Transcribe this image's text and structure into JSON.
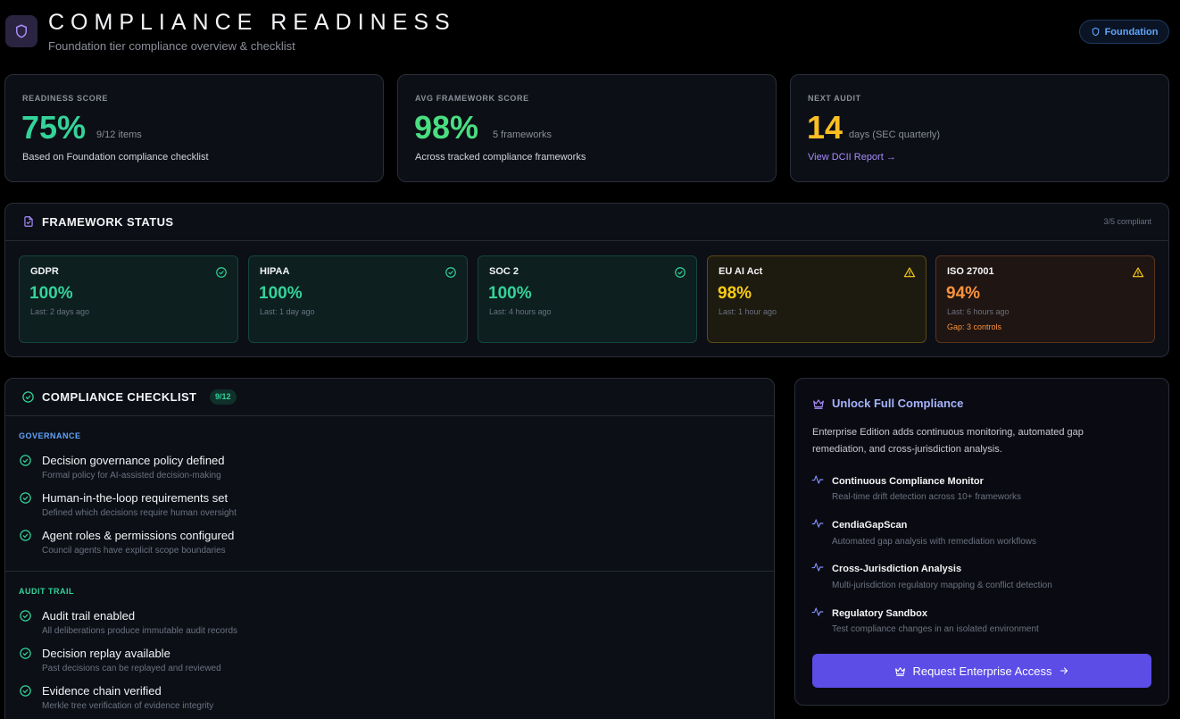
{
  "header": {
    "title": "COMPLIANCE READINESS",
    "subtitle": "Foundation tier compliance overview & checklist",
    "tier_badge": "Foundation"
  },
  "stats": [
    {
      "label": "READINESS SCORE",
      "value": "75%",
      "sub": "9/12 items",
      "desc": "Based on Foundation compliance checklist",
      "color": "#34d399"
    },
    {
      "label": "AVG FRAMEWORK SCORE",
      "value": "98%",
      "sub": "5 frameworks",
      "desc": "Across tracked compliance frameworks",
      "color": "#4ade80"
    },
    {
      "label": "NEXT AUDIT",
      "value": "14",
      "sub": "days (SEC quarterly)",
      "link": "View DCII Report →",
      "color": "#fbbf24"
    }
  ],
  "framework_status": {
    "title": "FRAMEWORK STATUS",
    "summary": "3/5 compliant",
    "items": [
      {
        "name": "GDPR",
        "score": "100%",
        "last": "Last: 2 days ago",
        "status": "ok",
        "icon": "check-circle-icon"
      },
      {
        "name": "HIPAA",
        "score": "100%",
        "last": "Last: 1 day ago",
        "status": "ok",
        "icon": "check-circle-icon"
      },
      {
        "name": "SOC 2",
        "score": "100%",
        "last": "Last: 4 hours ago",
        "status": "ok",
        "icon": "check-circle-icon"
      },
      {
        "name": "EU AI Act",
        "score": "98%",
        "last": "Last: 1 hour ago",
        "status": "warning",
        "icon": "warning-triangle-icon"
      },
      {
        "name": "ISO 27001",
        "score": "94%",
        "last": "Last: 6 hours ago",
        "gap": "Gap: 3 controls",
        "status": "warning",
        "icon": "warning-triangle-icon"
      }
    ]
  },
  "checklist": {
    "title": "COMPLIANCE CHECKLIST",
    "count": "9/12",
    "categories": [
      {
        "label": "GOVERNANCE",
        "color": "#60a5fa",
        "items": [
          {
            "title": "Decision governance policy defined",
            "desc": "Formal policy for AI-assisted decision-making"
          },
          {
            "title": "Human-in-the-loop requirements set",
            "desc": "Defined which decisions require human oversight"
          },
          {
            "title": "Agent roles & permissions configured",
            "desc": "Council agents have explicit scope boundaries"
          }
        ]
      },
      {
        "label": "AUDIT TRAIL",
        "color": "#34d399",
        "items": [
          {
            "title": "Audit trail enabled",
            "desc": "All deliberations produce immutable audit records"
          },
          {
            "title": "Decision replay available",
            "desc": "Past decisions can be replayed and reviewed"
          },
          {
            "title": "Evidence chain verified",
            "desc": "Merkle tree verification of evidence integrity"
          }
        ]
      }
    ]
  },
  "upsell": {
    "title": "Unlock Full Compliance",
    "desc_line1": "Enterprise Edition adds continuous monitoring, automated gap",
    "desc_line2": "remediation, and cross-jurisdiction analysis.",
    "features": [
      {
        "title": "Continuous Compliance Monitor",
        "desc": "Real-time drift detection across 10+ frameworks"
      },
      {
        "title": "CendiaGapScan",
        "desc": "Automated gap analysis with remediation workflows"
      },
      {
        "title": "Cross-Jurisdiction Analysis",
        "desc": "Multi-jurisdiction regulatory mapping & conflict detection"
      },
      {
        "title": "Regulatory Sandbox",
        "desc": "Test compliance changes in an isolated environment"
      }
    ],
    "cta": "Request Enterprise Access"
  }
}
